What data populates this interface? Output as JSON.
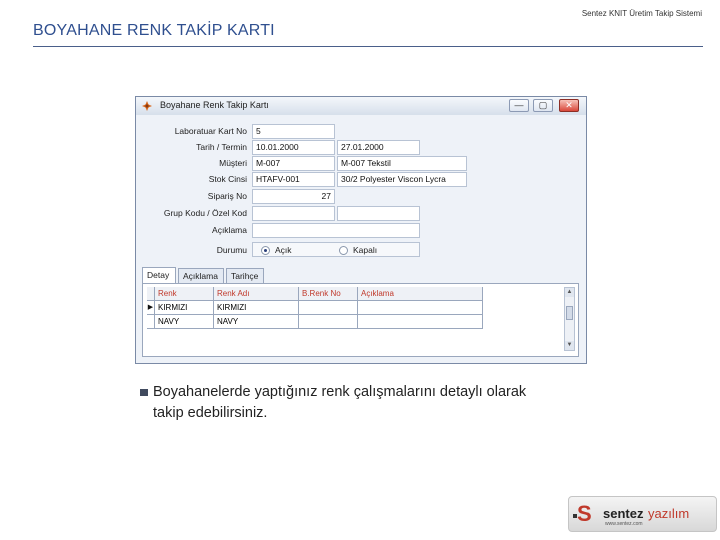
{
  "slide": {
    "title": "BOYAHANE RENK TAKİP KARTI",
    "top_right": "Sentez KNIT Üretim Takip Sistemi",
    "bullet": "Boyahanelerde yaptığınız renk çalışmalarını detaylı olarak takip edebilirsiniz."
  },
  "window": {
    "title": "Boyahane Renk Takip Kartı",
    "min_glyph": "—",
    "max_glyph": "▢",
    "close_glyph": "✕"
  },
  "form": {
    "lab_no_label": "Laboratuar Kart No",
    "lab_no_value": "5",
    "date_label": "Tarih / Termin",
    "date_value": "10.01.2000",
    "due_value": "27.01.2000",
    "customer_label": "Müşteri",
    "customer_code": "M-007",
    "customer_name": "M-007 Tekstil",
    "stock_label": "Stok Cinsi",
    "stock_code": "HTAFV-001",
    "stock_name": "30/2 Polyester Viscon Lycra",
    "order_label": "Sipariş No",
    "order_value": "27",
    "group_label": "Grup Kodu / Özel Kod",
    "desc_label": "Açıklama",
    "status_label": "Durumu",
    "status_open": "Açık",
    "status_closed": "Kapalı"
  },
  "tabs": [
    "Detay",
    "Açıklama",
    "Tarihçe"
  ],
  "grid": {
    "columns": [
      "Renk",
      "Renk Adı",
      "B.Renk No",
      "Açıklama"
    ],
    "rows": [
      [
        "KIRMIZI",
        "KIRMIZI",
        "",
        ""
      ],
      [
        "NAVY",
        "NAVY",
        "",
        ""
      ]
    ],
    "current_row_marker": "▶"
  },
  "logo": {
    "mark": "S",
    "brand_bold": "sentez",
    "brand_light": "yazılım",
    "sub": "www.sentez.com"
  }
}
